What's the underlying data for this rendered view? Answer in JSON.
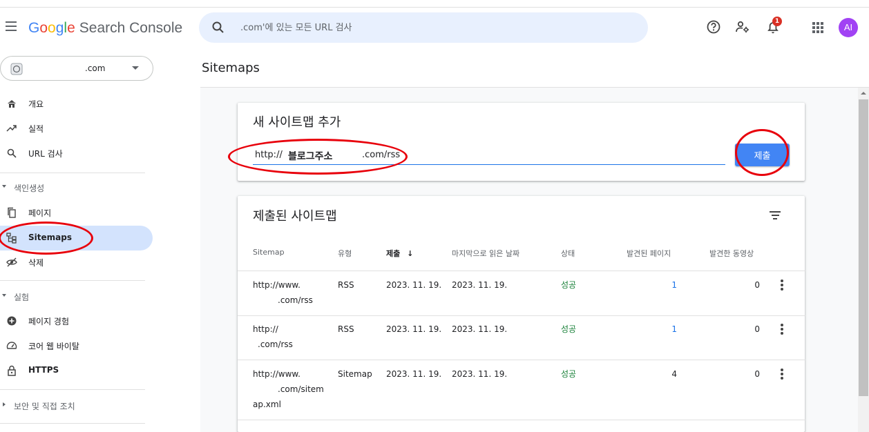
{
  "header": {
    "logo_letters": [
      "G",
      "o",
      "o",
      "g",
      "l",
      "e"
    ],
    "product": "Search Console",
    "search_placeholder": ".com'에 있는 모든 URL 검사",
    "notification_count": "1",
    "avatar_initials": "AI"
  },
  "sidebar": {
    "property_name": ".com",
    "items": [
      {
        "label": "개요"
      },
      {
        "label": "실적"
      },
      {
        "label": "URL 검사"
      }
    ],
    "section_indexing": "색인생성",
    "indexing_items": [
      {
        "label": "페이지"
      },
      {
        "label": "Sitemaps"
      },
      {
        "label": "삭제"
      }
    ],
    "section_experience": "실험",
    "experience_items": [
      {
        "label": "페이지 경험"
      },
      {
        "label": "코어 웹 바이탈"
      },
      {
        "label": "HTTPS"
      }
    ],
    "section_security": "보안 및 직접 조치"
  },
  "page": {
    "title": "Sitemaps"
  },
  "add_sitemap": {
    "title": "새 사이트맵 추가",
    "input_prefix": "http://",
    "input_bold": "블로그주소",
    "input_suffix": ".com/rss",
    "submit_label": "제출"
  },
  "submitted": {
    "title": "제출된 사이트맵",
    "columns": [
      "Sitemap",
      "유형",
      "제출",
      "마지막으로 읽은 날짜",
      "상태",
      "발견된 페이지",
      "발견한 동영상"
    ],
    "sort_arrow": "↓",
    "rows": [
      {
        "sitemap_l1": "http://www.",
        "sitemap_l2": ".com/rss",
        "sitemap_l3": "",
        "type": "RSS",
        "submitted": "2023. 11. 19.",
        "last_read": "2023. 11. 19.",
        "status": "성공",
        "pages": "1",
        "videos": "0"
      },
      {
        "sitemap_l1": "http://",
        "sitemap_l2": ".com/rss",
        "sitemap_l3": "",
        "type": "RSS",
        "submitted": "2023. 11. 19.",
        "last_read": "2023. 11. 19.",
        "status": "성공",
        "pages": "1",
        "videos": "0"
      },
      {
        "sitemap_l1": "http://www.",
        "sitemap_l2": ".com/sitem",
        "sitemap_l3": "ap.xml",
        "type": "Sitemap",
        "submitted": "2023. 11. 19.",
        "last_read": "2023. 11. 19.",
        "status": "성공",
        "pages": "4",
        "videos": "0"
      }
    ]
  },
  "colors": {
    "accent": "#1a73e8",
    "active_nav": "#d3e3fd",
    "success": "#188038",
    "annotation": "#e8000b"
  }
}
